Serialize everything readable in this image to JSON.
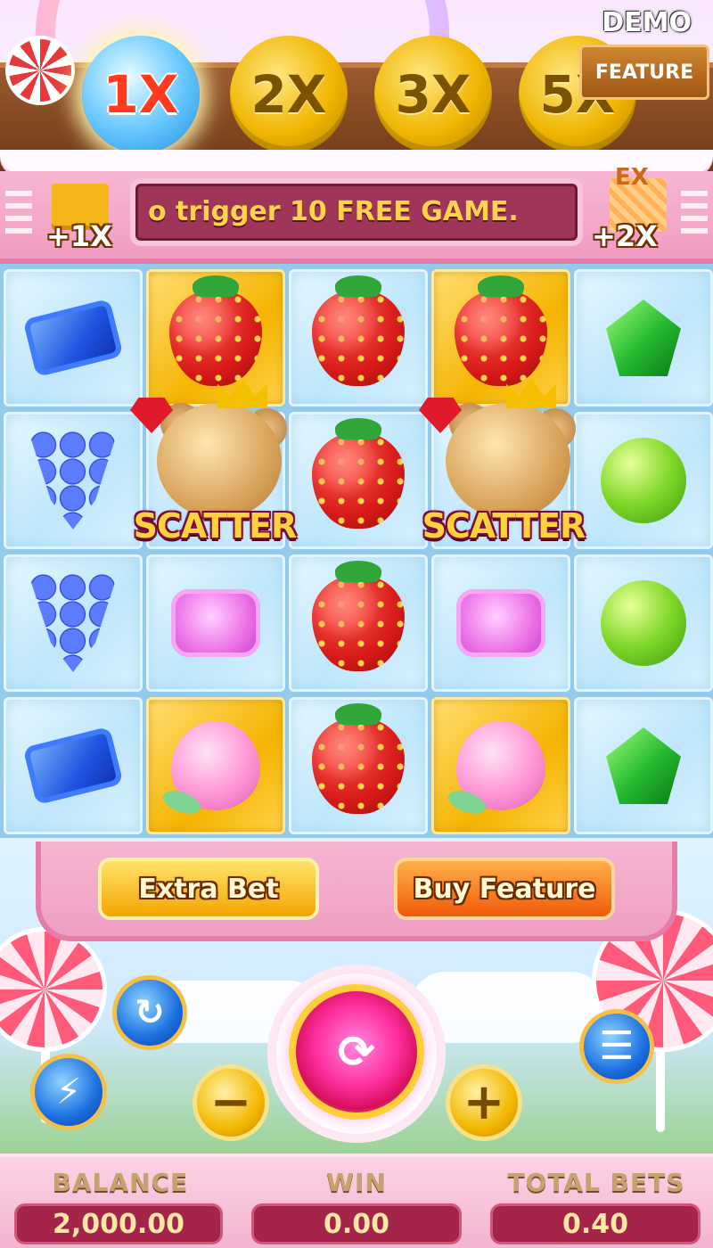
{
  "top": {
    "demo_label": "DEMO",
    "feature_button": "FEATURE",
    "multipliers": [
      {
        "label": "1X",
        "active": true
      },
      {
        "label": "2X",
        "active": false
      },
      {
        "label": "3X",
        "active": false
      },
      {
        "label": "5X",
        "active": false
      }
    ]
  },
  "banner": {
    "message": "o trigger 10 FREE GAME.",
    "left_bonus": "+1X",
    "right_bonus": "+2X",
    "right_badge": "EX"
  },
  "grid": {
    "columns": 5,
    "rows": 4,
    "cells": [
      [
        "blue-candy",
        "strawberry",
        "strawberry",
        "strawberry",
        "green-gem"
      ],
      [
        "grapes",
        "scatter",
        "strawberry",
        "scatter",
        "lime"
      ],
      [
        "grapes",
        "pink-candy",
        "strawberry",
        "pink-candy",
        "lime"
      ],
      [
        "blue-candy",
        "peach",
        "strawberry",
        "peach",
        "green-gem"
      ]
    ],
    "highlighted": [
      [
        0,
        1
      ],
      [
        0,
        3
      ],
      [
        3,
        1
      ],
      [
        3,
        3
      ]
    ],
    "scatter_label": "SCATTER"
  },
  "buttons": {
    "extra_bet": "Extra Bet",
    "buy_feature": "Buy Feature"
  },
  "footer": {
    "balance_label": "BALANCE",
    "balance_value": "2,000.00",
    "win_label": "WIN",
    "win_value": "0.00",
    "total_bets_label": "TOTAL BETS",
    "total_bets_value": "0.40"
  },
  "colors": {
    "gold": "#f5b400",
    "pink": "#f09ec3",
    "panel_red": "#a5244a"
  }
}
